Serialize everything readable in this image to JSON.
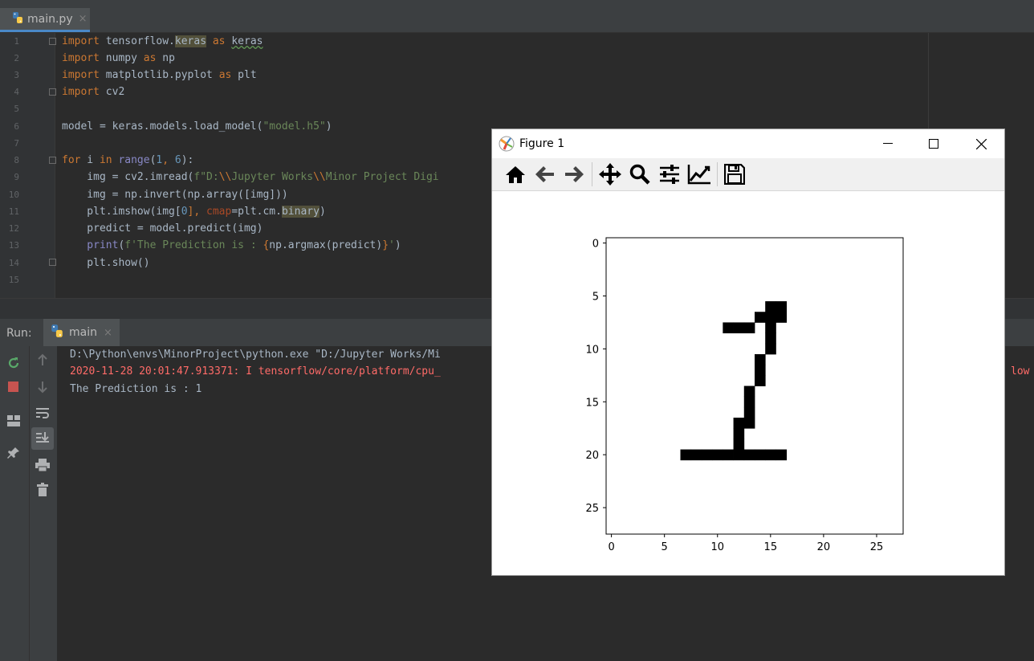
{
  "editor": {
    "tab": {
      "label": "main.py",
      "close": "×"
    },
    "line_numbers": [
      "1",
      "2",
      "3",
      "4",
      "5",
      "6",
      "7",
      "8",
      "9",
      "10",
      "11",
      "12",
      "13",
      "14",
      "15"
    ],
    "lines": {
      "l1": {
        "kw1": "import",
        "t1": " tensorflow.",
        "hl": "keras",
        "kw2": " as ",
        "t2": "keras"
      },
      "l2": {
        "kw1": "import",
        "t1": " numpy ",
        "kw2": "as",
        "t2": " np"
      },
      "l3": {
        "kw1": "import",
        "t1": " matplotlib.pyplot ",
        "kw2": "as",
        "t2": " plt"
      },
      "l4": {
        "kw1": "import",
        "t1": " cv2"
      },
      "l6": {
        "t1": "model = keras.models.load_model(",
        "s1": "\"model.h5\"",
        "t2": ")"
      },
      "l8": {
        "kw1": "for",
        "t1": " i ",
        "kw2": "in",
        "b1": " range",
        "t2": "(",
        "n1": "1",
        "t3": ", ",
        "n2": "6",
        "t4": "):"
      },
      "l9": {
        "t1": "    img = cv2.imread(",
        "s1": "f\"D:",
        "e1": "\\\\",
        "s2": "Jupyter Works",
        "e2": "\\\\",
        "s3": "Minor Project Digi"
      },
      "l10": {
        "t1": "    img = np.invert(np.array([img]))"
      },
      "l11": {
        "t1": "    plt.imshow(img[",
        "n1": "0",
        "t2": "], ",
        "p1": "cmap",
        "t3": "=plt.cm.",
        "hl": "binary",
        "t4": ")"
      },
      "l12": {
        "t1": "    predict = model.predict(img)"
      },
      "l13": {
        "b1": "    print",
        "t1": "(",
        "s1": "f'The Prediction is : ",
        "k1": "{",
        "t2": "np.argmax(predict)",
        "k2": "}",
        "s2": "'",
        "t3": ")"
      },
      "l14": {
        "t1": "    plt.show()"
      }
    }
  },
  "run": {
    "label": "Run:",
    "tab_label": "main",
    "tab_close": "×",
    "console": [
      {
        "text": "D:\\Python\\envs\\MinorProject\\python.exe \"D:/Jupyter Works/Mi",
        "color": "#a9b7c6"
      },
      {
        "text": "2020-11-28 20:01:47.913371: I tensorflow/core/platform/cpu_",
        "color": "#ff6b68"
      },
      {
        "text": "The Prediction is : 1",
        "color": "#a9b7c6"
      }
    ],
    "console_tail": "low k"
  },
  "figure": {
    "title": "Figure 1",
    "toolbar_icons": [
      "home-icon",
      "back-arrow-icon",
      "forward-arrow-icon",
      "pan-icon",
      "zoom-icon",
      "configure-subplots-icon",
      "edit-axis-icon",
      "save-icon"
    ]
  },
  "chart_data": {
    "type": "heatmap",
    "title": "",
    "xlabel": "",
    "ylabel": "",
    "xlim": [
      -0.5,
      27.5
    ],
    "ylim": [
      27.5,
      -0.5
    ],
    "xticks": [
      "0",
      "5",
      "10",
      "15",
      "20",
      "25"
    ],
    "yticks": [
      "0",
      "5",
      "10",
      "15",
      "20",
      "25"
    ],
    "colormap": "binary",
    "grid": false,
    "black_cells": [
      [
        6,
        15
      ],
      [
        6,
        16
      ],
      [
        7,
        14
      ],
      [
        7,
        15
      ],
      [
        7,
        16
      ],
      [
        8,
        11
      ],
      [
        8,
        12
      ],
      [
        8,
        13
      ],
      [
        8,
        15
      ],
      [
        9,
        15
      ],
      [
        10,
        15
      ],
      [
        11,
        14
      ],
      [
        12,
        14
      ],
      [
        13,
        14
      ],
      [
        14,
        13
      ],
      [
        15,
        13
      ],
      [
        16,
        13
      ],
      [
        17,
        12
      ],
      [
        17,
        13
      ],
      [
        18,
        12
      ],
      [
        19,
        12
      ],
      [
        20,
        7
      ],
      [
        20,
        8
      ],
      [
        20,
        9
      ],
      [
        20,
        10
      ],
      [
        20,
        11
      ],
      [
        20,
        12
      ],
      [
        20,
        13
      ],
      [
        20,
        14
      ],
      [
        20,
        15
      ],
      [
        20,
        16
      ]
    ]
  }
}
